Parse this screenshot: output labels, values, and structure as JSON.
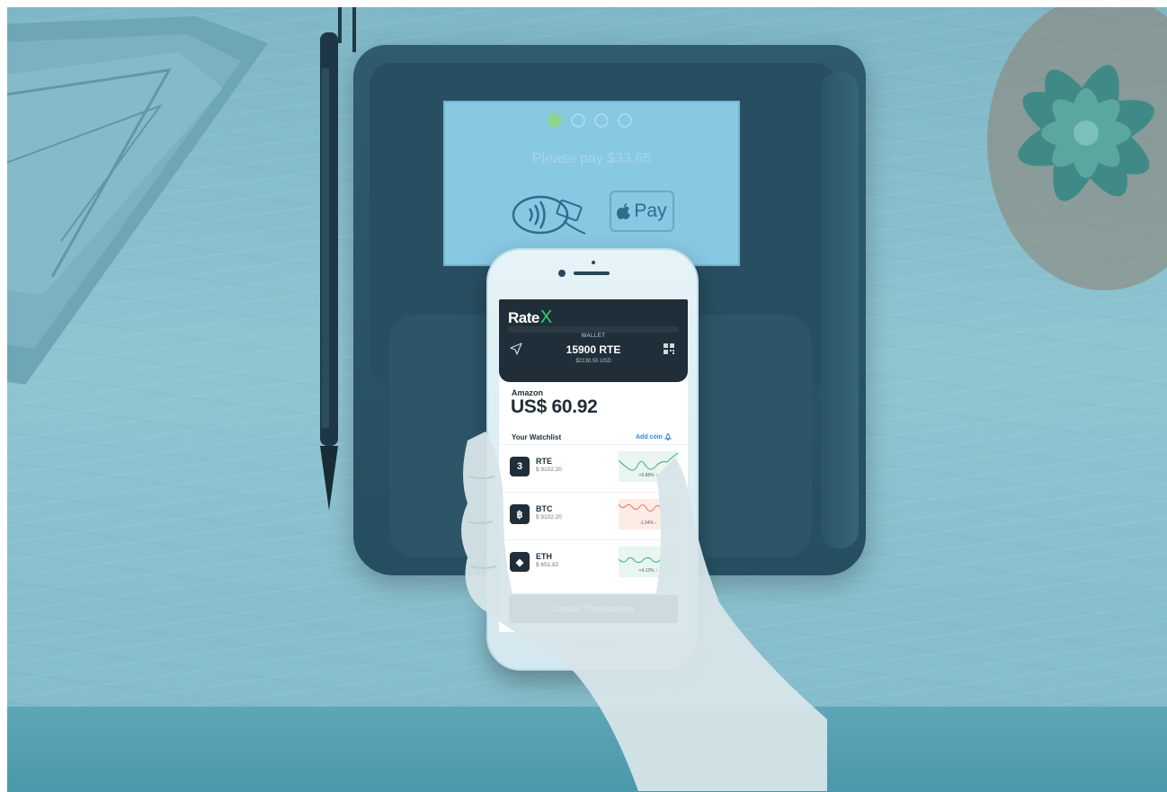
{
  "terminal": {
    "prompt": "Please pay $33.65",
    "step_total": 4,
    "step_current": 1,
    "apple_pay_label": "Pay",
    "icons": [
      "contactless-icon",
      "apple-logo-icon"
    ]
  },
  "app": {
    "brand_text": "Rate",
    "brand_mark": "X",
    "wallet": {
      "label": "WALLET",
      "amount": "15900 RTE",
      "usd": "$2130.55 USD"
    },
    "merchant": "Amazon",
    "total": "US$ 60.92",
    "watchlist_title": "Your Watchlist",
    "add_coin_label": "Add coin",
    "coins": [
      {
        "symbol": "RTE",
        "price": "$ 9102.20",
        "change": "+9.88% ↑",
        "trend": "up",
        "badge": "3"
      },
      {
        "symbol": "BTC",
        "price": "$ 9102.20",
        "change": "-1.04% ↓",
        "trend": "down",
        "badge": "฿"
      },
      {
        "symbol": "ETH",
        "price": "$ 651.82",
        "change": "+4.12% ↑",
        "trend": "up",
        "badge": "◆"
      }
    ],
    "cta_label": "Create Transaction",
    "colors": {
      "header": "#1f2e38",
      "accent_green": "#2fd36b",
      "link_blue": "#2e86d8",
      "up": "#3ca98a",
      "down": "#e8795c"
    }
  }
}
